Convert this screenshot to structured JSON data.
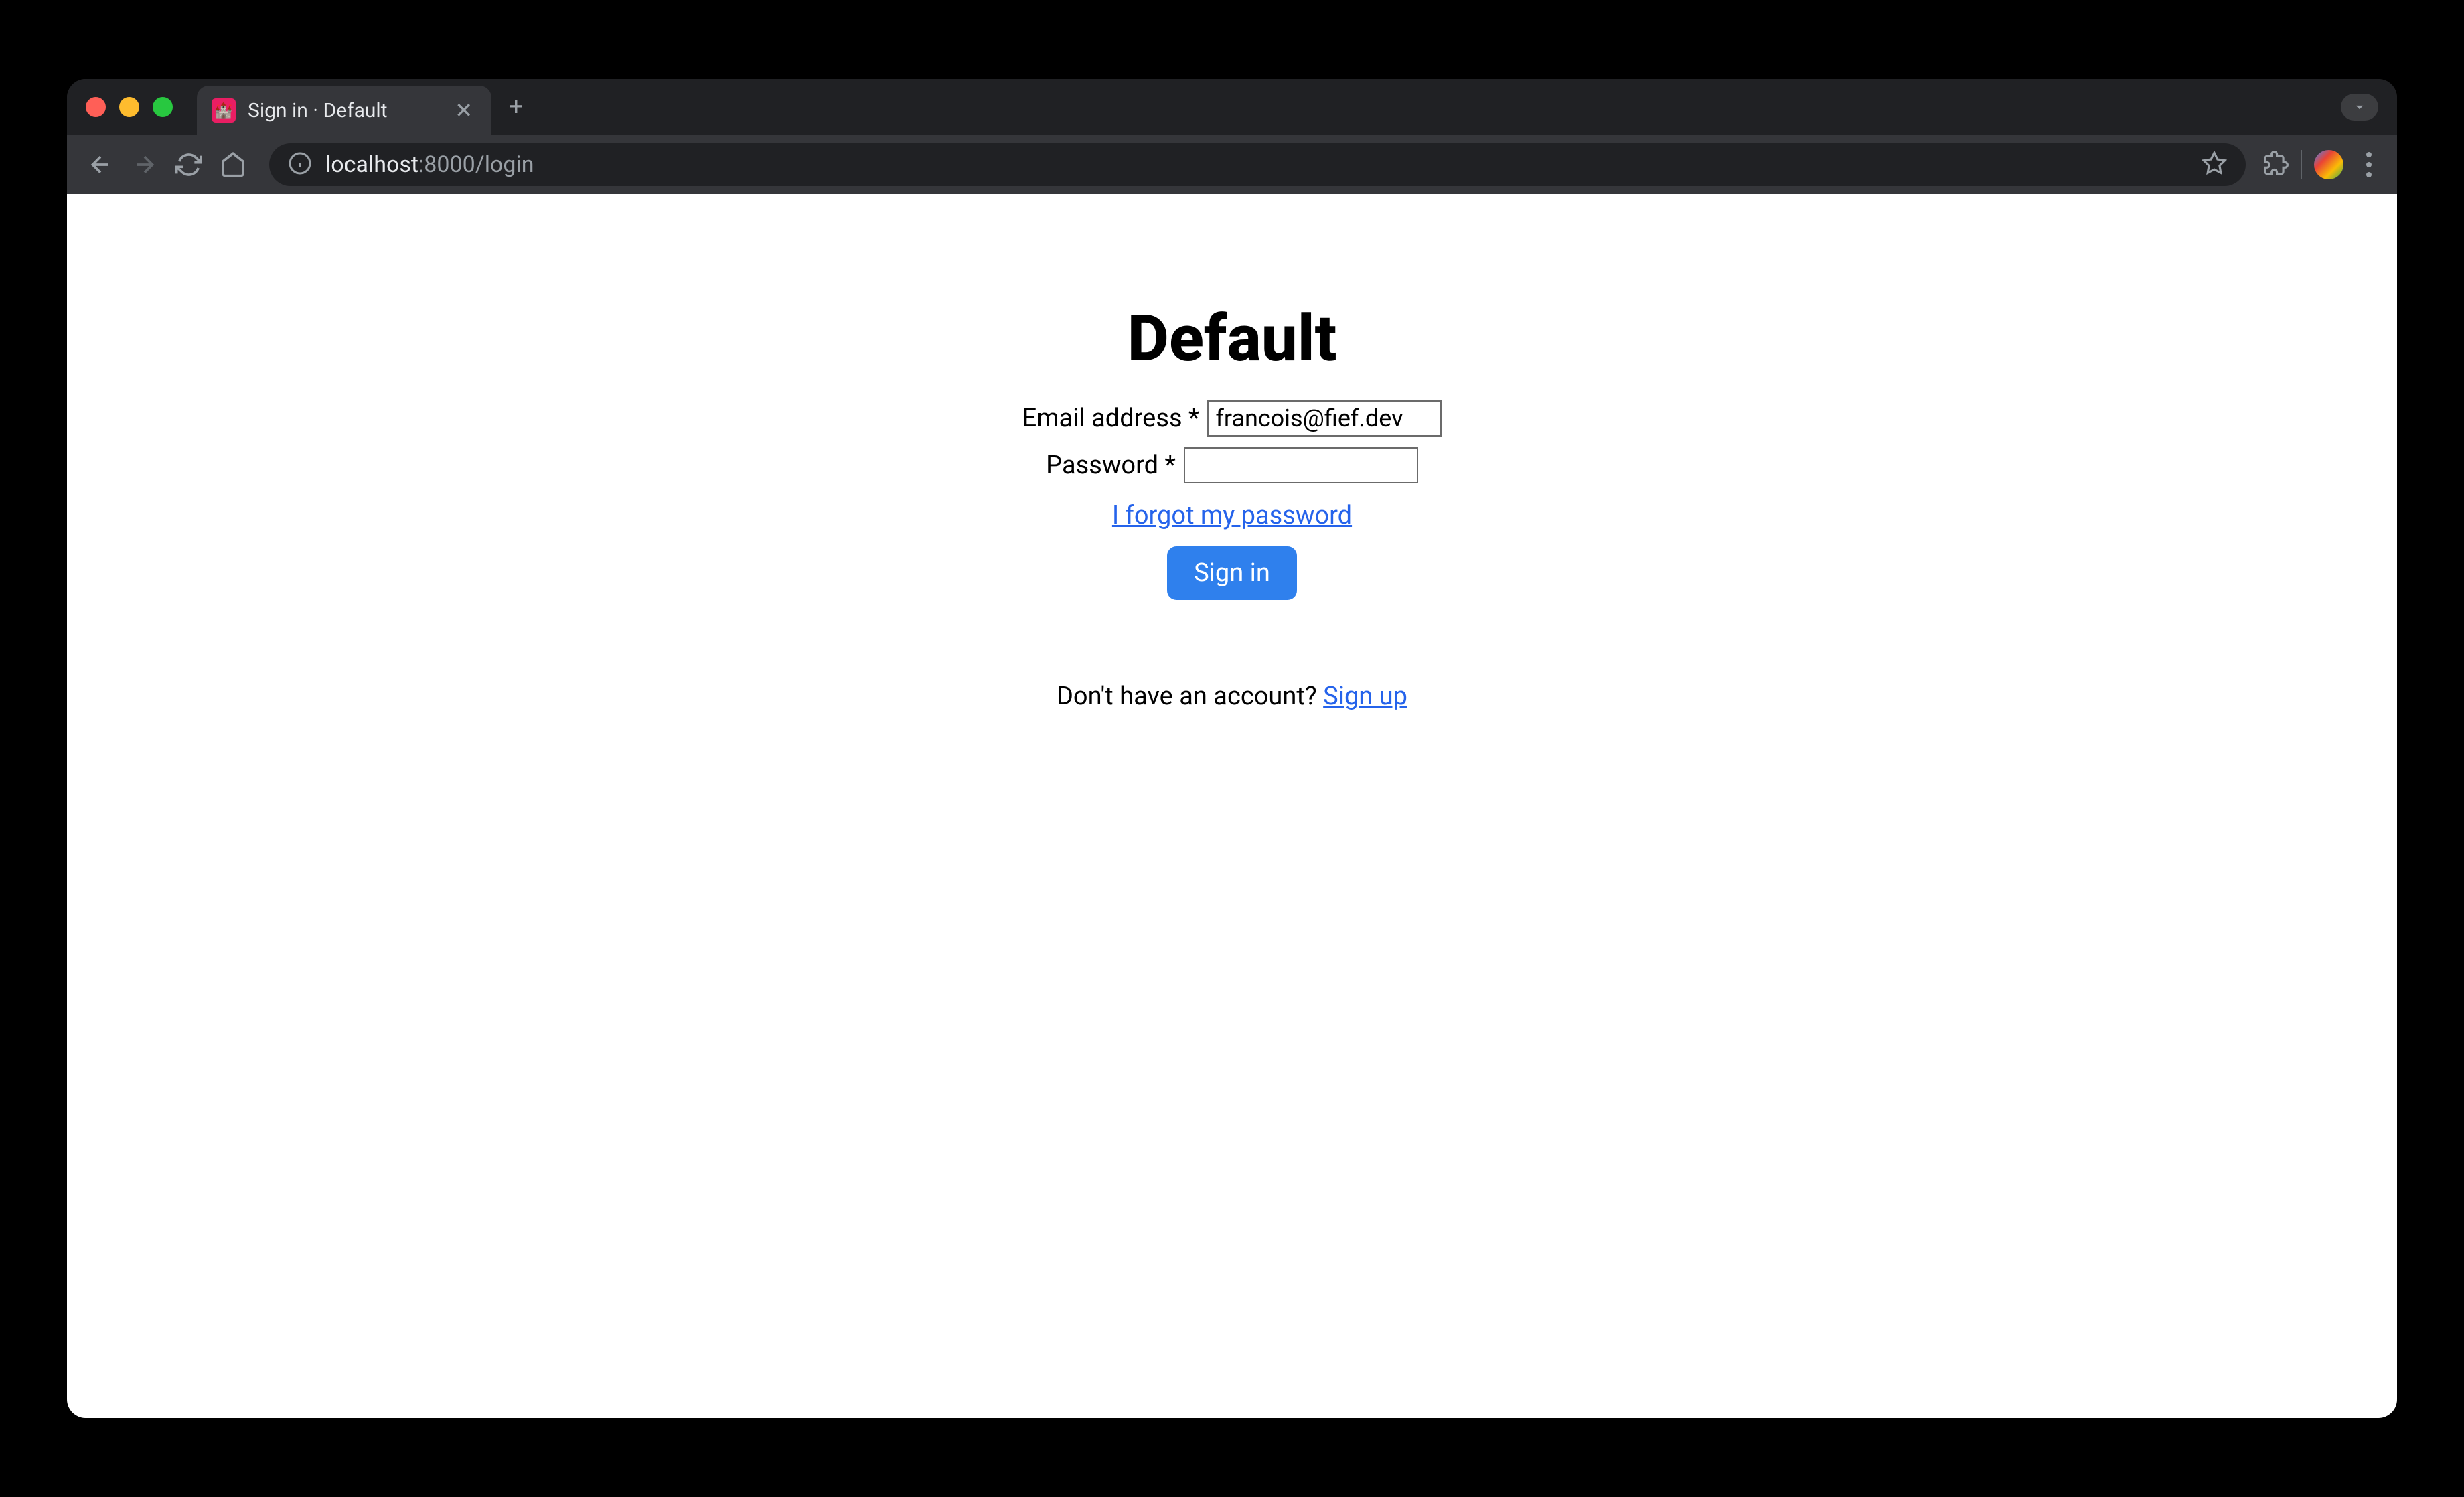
{
  "browser": {
    "tab_title": "Sign in · Default",
    "url_host": "localhost",
    "url_port_path": ":8000/login"
  },
  "page": {
    "title": "Default",
    "email_label": "Email address *",
    "email_value": "francois@fief.dev",
    "password_label": "Password *",
    "password_value": "",
    "forgot_link": "I forgot my password",
    "signin_button": "Sign in",
    "signup_prompt": "Don't have an account? ",
    "signup_link": "Sign up"
  }
}
